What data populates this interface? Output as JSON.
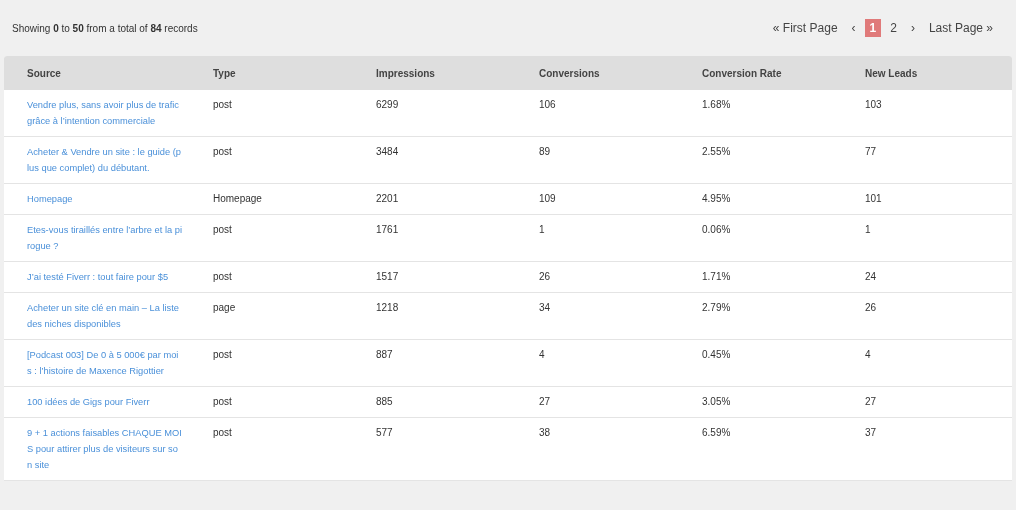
{
  "summary": "Showing **0** to **50** from a total of **84** records",
  "pagination": {
    "first": "« First Page",
    "prev": "‹",
    "pages": [
      {
        "label": "1",
        "selected": true
      },
      {
        "label": "2",
        "selected": false
      }
    ],
    "next": "›",
    "last": "Last Page »"
  },
  "table": {
    "columns": [
      "Source",
      "Type",
      "Impressions",
      "Conversions",
      "Conversion Rate",
      "New Leads"
    ],
    "rows": [
      {
        "source": "Vendre plus, sans avoir plus de trafic grâce à l’intention commerciale",
        "type": "post",
        "impressions": "6299",
        "conversions": "106",
        "rate": "1.68%",
        "leads": "103"
      },
      {
        "source": "Acheter & Vendre un site : le guide (plus que complet) du débutant.",
        "type": "post",
        "impressions": "3484",
        "conversions": "89",
        "rate": "2.55%",
        "leads": "77"
      },
      {
        "source": "Homepage",
        "type": "Homepage",
        "impressions": "2201",
        "conversions": "109",
        "rate": "4.95%",
        "leads": "101"
      },
      {
        "source": "Etes-vous tiraillés entre l’arbre et la pirogue ?",
        "type": "post",
        "impressions": "1761",
        "conversions": "1",
        "rate": "0.06%",
        "leads": "1"
      },
      {
        "source": "J’ai testé Fiverr : tout faire pour $5",
        "type": "post",
        "impressions": "1517",
        "conversions": "26",
        "rate": "1.71%",
        "leads": "24"
      },
      {
        "source": "Acheter un site clé en main – La liste des niches disponibles",
        "type": "page",
        "impressions": "1218",
        "conversions": "34",
        "rate": "2.79%",
        "leads": "26"
      },
      {
        "source": "[Podcast 003] De 0 à 5 000€ par mois : l’histoire de Maxence Rigottier",
        "type": "post",
        "impressions": "887",
        "conversions": "4",
        "rate": "0.45%",
        "leads": "4"
      },
      {
        "source": "100 idées de Gigs pour Fiverr",
        "type": "post",
        "impressions": "885",
        "conversions": "27",
        "rate": "3.05%",
        "leads": "27"
      },
      {
        "source": "9 + 1 actions faisables CHAQUE MOIS pour attirer plus de visiteurs sur son site",
        "type": "post",
        "impressions": "577",
        "conversions": "38",
        "rate": "6.59%",
        "leads": "37"
      }
    ]
  }
}
